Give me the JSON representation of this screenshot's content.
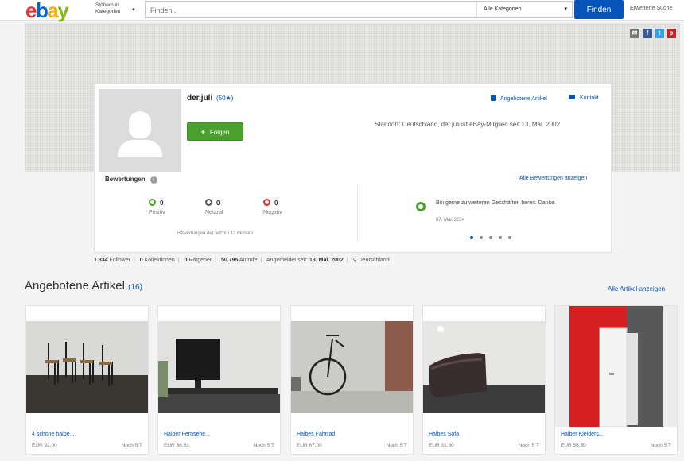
{
  "colors": {
    "link": "#0654ba",
    "find_button": "#0654ba",
    "follow_button": "#4aa02c",
    "positive": "#4aa02c",
    "neutral": "#555555",
    "negative": "#d8342d"
  },
  "header": {
    "logo": {
      "e": "e",
      "b": "b",
      "a": "a",
      "y": "y"
    },
    "browse_label": "Stöbern in Kategorien",
    "search_placeholder": "Finden...",
    "category_select": "Alle Kategorien",
    "find_button": "Finden",
    "advanced_search": "Erweiterte Suche"
  },
  "share_icons": [
    "mail-icon",
    "facebook-icon",
    "twitter-icon",
    "pinterest-icon"
  ],
  "profile": {
    "username": "der.juli",
    "score": "(50★)",
    "follow_button": "Folgen",
    "offered_items_link": "Angebotene Artikel",
    "contact_link": "Kontakt",
    "location_line": "Standort: Deutschland, der.juli ist eBay-Mitglied seit 13. Mai. 2002"
  },
  "ratings": {
    "title": "Bewertungen",
    "all_link": "Alle Bewertungen anzeigen",
    "positive": {
      "count": "0",
      "label": "Positiv"
    },
    "neutral": {
      "count": "0",
      "label": "Neutral"
    },
    "negative": {
      "count": "0",
      "label": "Negativ"
    },
    "note": "Bewertungen der letzten 12 Monate",
    "feedback_text": "Bin gerne zu weiteren Geschäften bereit. Danke.",
    "feedback_date": "07. Mai. 2014",
    "carousel_pages": 5,
    "carousel_active": 1
  },
  "stats": {
    "followers": "1.334",
    "followers_label": "Follower",
    "collections": "0",
    "collections_label": "Kollektionen",
    "guides": "0",
    "guides_label": "Ratgeber",
    "views": "50.795",
    "views_label": "Aufrufe",
    "member_since_label": "Angemeldet seit:",
    "member_since": "13. Mai. 2002",
    "country": "Deutschland"
  },
  "items_section": {
    "title": "Angebotene Artikel",
    "count": "(16)",
    "all_link": "Alle Artikel anzeigen",
    "items": [
      {
        "title": "4 schöne halbe...",
        "price": "EUR 92,00",
        "time": "Noch 5 T"
      },
      {
        "title": "Halber Fernsehe...",
        "price": "EUR 36,93",
        "time": "Noch 5 T"
      },
      {
        "title": "Halbes Fahrrad",
        "price": "EUR 67,00",
        "time": "Noch 5 T"
      },
      {
        "title": "Halbes Sofa",
        "price": "EUR 31,50",
        "time": "Noch 5 T"
      },
      {
        "title": "Halber Kleiders...",
        "price": "EUR 56,50",
        "time": "Noch 5 T"
      }
    ]
  }
}
